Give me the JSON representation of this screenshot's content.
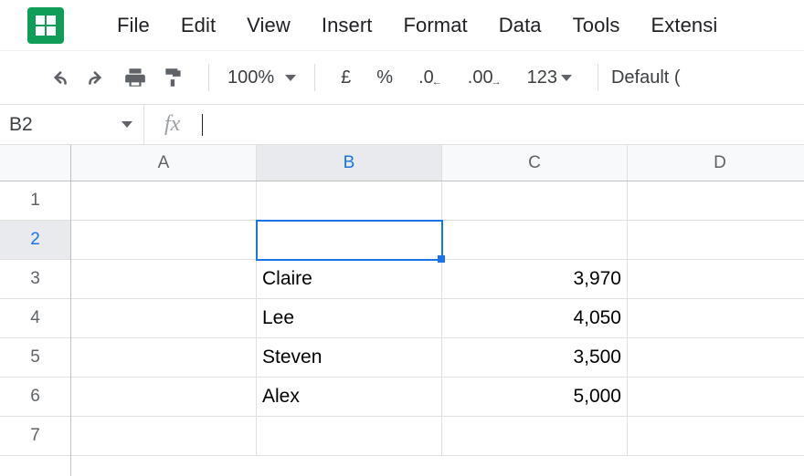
{
  "menubar": {
    "items": [
      "File",
      "Edit",
      "View",
      "Insert",
      "Format",
      "Data",
      "Tools",
      "Extensi"
    ]
  },
  "toolbar": {
    "zoom": "100%",
    "currency": "£",
    "percent": "%",
    "dec_decrease": ".0",
    "dec_increase": ".00",
    "num_format": "123",
    "font": "Default ("
  },
  "namebox": {
    "ref": "B2"
  },
  "formula_bar": {
    "value": ""
  },
  "columns": [
    "A",
    "B",
    "C",
    "D"
  ],
  "rows": [
    "1",
    "2",
    "3",
    "4",
    "5",
    "6",
    "7"
  ],
  "active": {
    "row_index": 1,
    "col_index": 1
  },
  "cells": {
    "r3": {
      "B": "Claire",
      "C": "3,970"
    },
    "r4": {
      "B": "Lee",
      "C": "4,050"
    },
    "r5": {
      "B": "Steven",
      "C": "3,500"
    },
    "r6": {
      "B": "Alex",
      "C": "5,000"
    }
  }
}
